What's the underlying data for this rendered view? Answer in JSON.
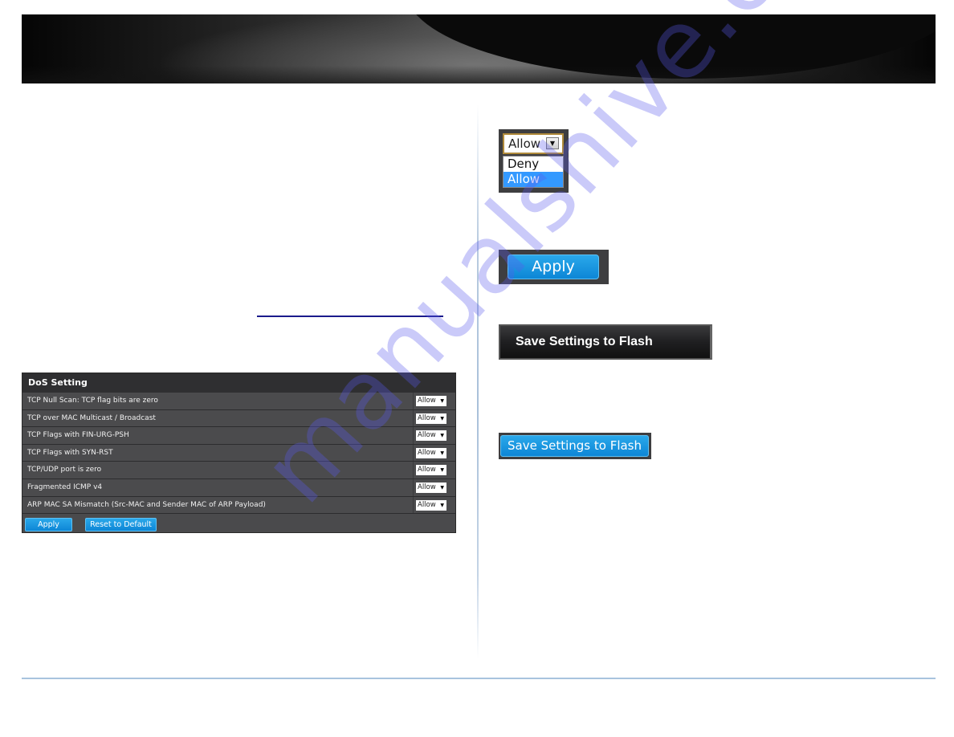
{
  "banner": {
    "icon": "header-banner-graphic"
  },
  "link": {
    "text": ""
  },
  "dos_panel": {
    "title": "DoS Setting",
    "rows": [
      {
        "label": "TCP Null Scan: TCP flag bits are zero",
        "value": "Allow"
      },
      {
        "label": "TCP over MAC Multicast / Broadcast",
        "value": "Allow"
      },
      {
        "label": "TCP Flags with FIN-URG-PSH",
        "value": "Allow"
      },
      {
        "label": "TCP Flags with SYN-RST",
        "value": "Allow"
      },
      {
        "label": "TCP/UDP port is zero",
        "value": "Allow"
      },
      {
        "label": "Fragmented ICMP v4",
        "value": "Allow"
      },
      {
        "label": "ARP MAC SA Mismatch (Src-MAC and Sender MAC of ARP Payload)",
        "value": "Allow"
      }
    ],
    "select_arrow": "▼",
    "apply_label": "Apply",
    "reset_label": "Reset to Default"
  },
  "figures": {
    "dropdown": {
      "selected": "Allow",
      "arrow": "▼",
      "options": [
        "Deny",
        "Allow"
      ],
      "highlighted": "Allow"
    },
    "apply_label": "Apply",
    "save_dark_label": "Save Settings to Flash",
    "save_blue_label": "Save Settings to Flash"
  },
  "watermark": {
    "text": "manualshive.com"
  },
  "colors": {
    "button_blue": "#0d86d6",
    "panel_bg": "#4a4a4c",
    "highlight": "#3399ff",
    "footer_line": "#a8c4de",
    "link": "#1a1a8c"
  }
}
